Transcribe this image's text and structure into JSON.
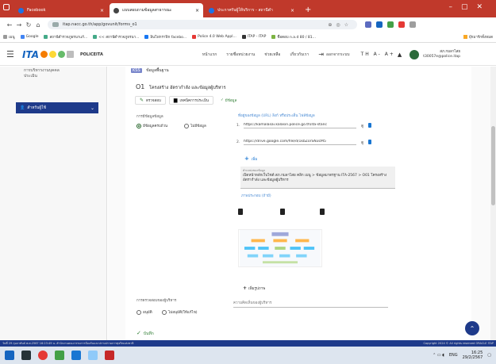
{
  "browser": {
    "tabs": [
      {
        "title": "Facebook",
        "active": false
      },
      {
        "title": "แบบสอบถามข้อมูลสาธารณะ",
        "active": true
      },
      {
        "title": "ประกาศรับผู้ให้บริการ - สถานีตำ",
        "active": false
      }
    ],
    "new_tab": "+",
    "url": "itap.nacc.go.th/app/govunit/forms_o1",
    "bookmarks": [
      "เมนู",
      "Google",
      "สถานีตำรวจภูธรนาแก้...",
      "<< สถานีตำรวจภูธรนา...",
      "อินโฟกราฟิก facebo...",
      "Police 4.0 Web Appl...",
      "ITAP - ITAP",
      "ชื่อตอบ n.a.d 80 / 81..."
    ],
    "bookmarks_right": "บุ๊กมาร์กทั้งหมด"
  },
  "header": {
    "brand": "POLICEITA",
    "nav": [
      "หน้าแรก",
      "รายชื่อหน่วยงาน",
      "ช่วยเหลือ",
      "เกี่ยวกับเรา",
      "ออกจากระบบ"
    ],
    "font_controls": "TH A- A+",
    "user_name": "สภ.กมลาไสย",
    "user_email": "t30057e@police.itap"
  },
  "sidebar": {
    "prev_item": "การบริหารงานบุคคล\nประเมิน",
    "active_item": "สำหรับผู้ใช้"
  },
  "main": {
    "section_badge": "KSS",
    "section_title": "ข้อมูลพื้นฐาน",
    "item_code": "O1",
    "item_title": "โครงสร้าง อัตรากำลัง และข้อมูลผู้บริหาร",
    "buttons": {
      "edit": "ตรวจสอบ",
      "print": "เทคนิคการประเมิน",
      "done": "มีข้อมูล"
    },
    "data_label": "การมีข้อมูลข้อมูล",
    "radio_has": "มีข้อมูลครบถ้วน",
    "radio_none": "ไม่มีข้อมูล",
    "links_header": "ที่อยู่ของข้อมูล (URL) ลิงก์ หรือประเด็น ไฟล์ข้อมูล",
    "links": [
      {
        "num": "1.",
        "url": "https://kamalasai.kalasin.police.go.th/ita-stanc",
        "action": "ดู"
      },
      {
        "num": "2.",
        "url": "https://drive.google.com/file/d/1kbZorSN3cM5",
        "action": "ดู"
      }
    ],
    "add_link": "เพิ่ม",
    "path_label": "ตำแหน่งของข้อมูล",
    "path_value": "เปิดหน้าหลักเว็บไซต์ สภ.กมลาไสย คลิก เมนู > ข้อมูลมาตรฐาน ITA-2567 > O01 โครงสร้าง อัตรากำลัง และข้อมูลผู้บริหาร",
    "images_label": "ภาพประกอบ (ถ้ามี)",
    "add_image": "เพิ่มรูปภาพ",
    "check_label": "การตรวจสอบของผู้บริหาร",
    "responsible_placeholder": "ความคิดเห็นของผู้บริหาร",
    "approve_yes": "อนุมัติ",
    "approve_no": "ไม่อนุมัติ(ให้แก้ไข)",
    "save": "บันทึก"
  },
  "statusbar": {
    "left": "วันที่ 29 กุมภาพันธ์ พ.ศ.2567 16:23:49 น. สำนักงานคณะกรรมการป้องกันและปราบปรามการทุจริตแห่งชาติ",
    "right": "Copyright 2024 © All rights reserved   ORACLE   ITAP"
  },
  "taskbar": {
    "lang": "ENG",
    "time": "16:25",
    "date": "29/2/2567"
  },
  "colors": {
    "tab_strip": "#c0392b",
    "sidebar_active": "#1e3a8a",
    "accent_green": "#2e7d32",
    "link_blue": "#1976d2"
  }
}
